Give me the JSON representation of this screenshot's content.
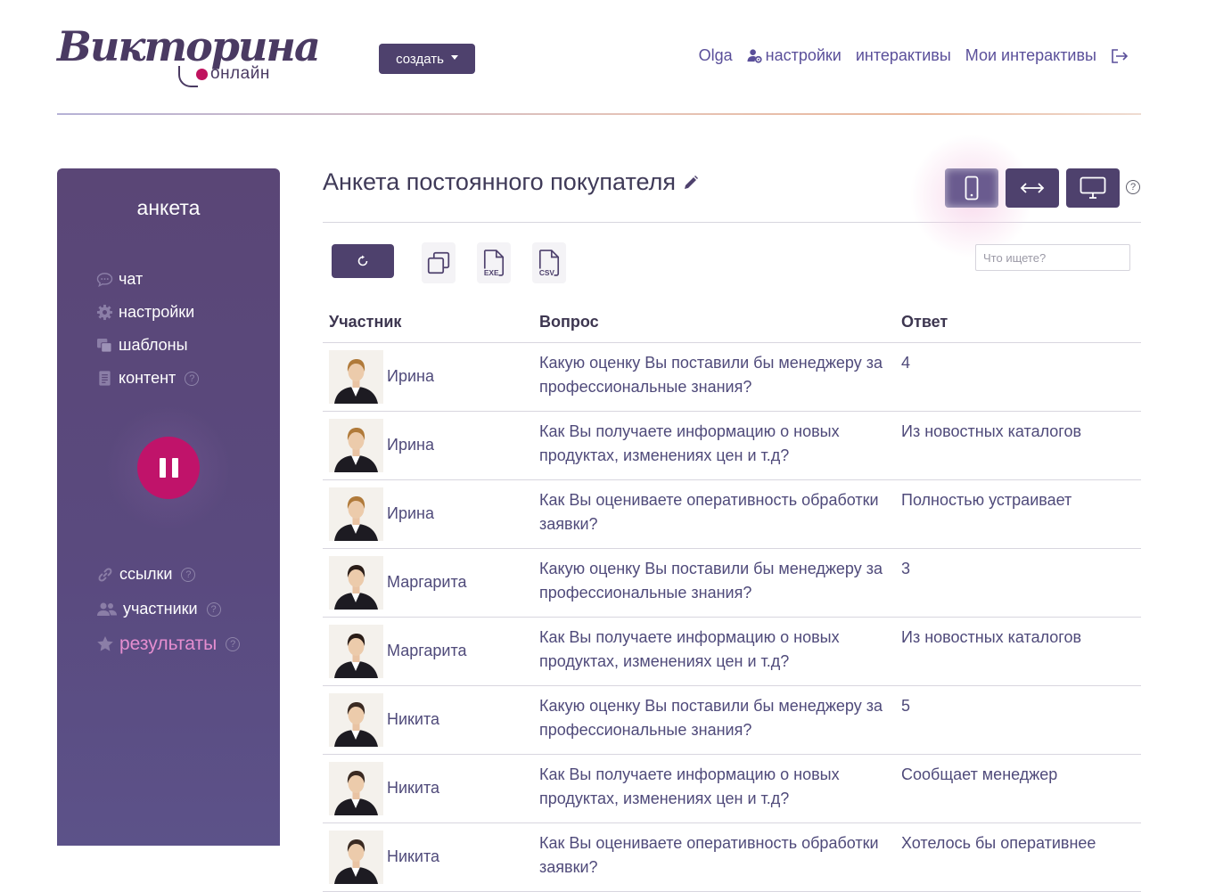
{
  "app": {
    "logo_main": "Викторина",
    "logo_sub": "онлайн",
    "create_button": "создать"
  },
  "topnav": {
    "user": "Olga",
    "settings": "настройки",
    "interactives": "интерактивы",
    "my_interactives": "Мои интерактивы"
  },
  "sidebar": {
    "title": "анкета",
    "menu": [
      {
        "label": "чат",
        "icon": "chat-bubble-icon"
      },
      {
        "label": "настройки",
        "icon": "gear-icon"
      },
      {
        "label": "шаблоны",
        "icon": "copy-icon"
      },
      {
        "label": "контент",
        "icon": "document-icon"
      }
    ],
    "lower_menu": [
      {
        "label": "ссылки",
        "icon": "link-icon"
      },
      {
        "label": "участники",
        "icon": "users-icon"
      },
      {
        "label": "результаты",
        "icon": "star-icon"
      }
    ],
    "help_mark": "?",
    "pause_icon": "pause-icon"
  },
  "main": {
    "title": "Анкета постоянного покупателя",
    "help_mark": "?",
    "search_placeholder": "Что ищете?",
    "export_exe": "EXE",
    "export_csv": "CSV"
  },
  "table": {
    "headers": {
      "participant": "Участник",
      "question": "Вопрос",
      "answer": "Ответ"
    },
    "rows": [
      {
        "participant": "Ирина",
        "question": "Какую оценку Вы поставили бы менеджеру за профессиональные знания?",
        "answer": "4"
      },
      {
        "participant": "Ирина",
        "question": "Как Вы получаете информацию о новых продуктах, изменениях цен и т.д?",
        "answer": "Из новостных каталогов"
      },
      {
        "participant": "Ирина",
        "question": "Как Вы оцениваете оперативность обработки заявки?",
        "answer": "Полностью устраивает"
      },
      {
        "participant": "Маргарита",
        "question": "Какую оценку Вы поставили бы менеджеру за профессиональные знания?",
        "answer": "3"
      },
      {
        "participant": "Маргарита",
        "question": "Как Вы получаете информацию о новых продуктах, изменениях цен и т.д?",
        "answer": "Из новостных каталогов"
      },
      {
        "participant": "Никита",
        "question": "Какую оценку Вы поставили бы менеджеру за профессиональные знания?",
        "answer": "5"
      },
      {
        "participant": "Никита",
        "question": "Как Вы получаете информацию о новых продуктах, изменениях цен и т.д?",
        "answer": "Сообщает менеджер"
      },
      {
        "participant": "Никита",
        "question": "Как Вы оцениваете оперативность обработки заявки?",
        "answer": "Хотелось бы оперативнее"
      }
    ]
  },
  "colors": {
    "brand": "#4e416d",
    "accent": "#c0136a",
    "link": "#5a4f9a",
    "active_menu": "#e58ed0"
  }
}
